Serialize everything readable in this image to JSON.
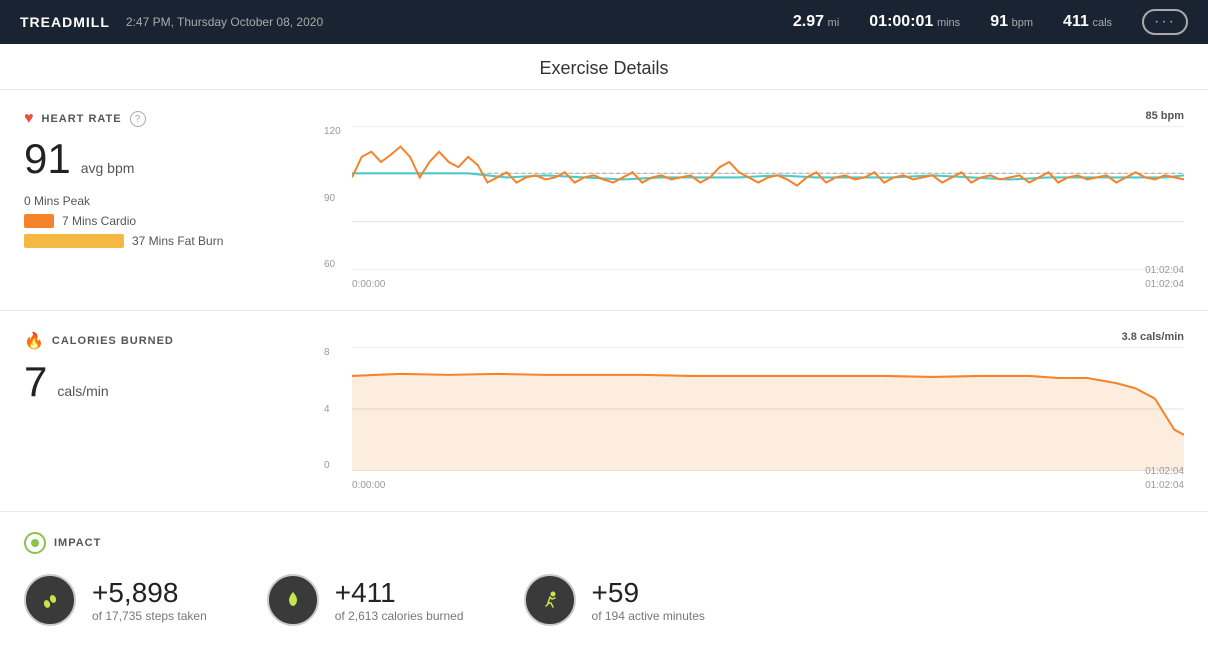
{
  "topbar": {
    "title": "TREADMILL",
    "datetime": "2:47 PM, Thursday October 08, 2020",
    "stats": [
      {
        "value": "2.97",
        "unit": "mi"
      },
      {
        "value": "01:00:01",
        "unit": "mins"
      },
      {
        "value": "91",
        "unit": "bpm"
      },
      {
        "value": "411",
        "unit": "cals"
      }
    ],
    "more_label": "···"
  },
  "page_title": "Exercise Details",
  "heart_rate": {
    "section_title": "HEART RATE",
    "avg_value": "91",
    "avg_unit": "avg bpm",
    "zones": [
      {
        "label": "0 Mins Peak",
        "color": null,
        "swatch_width": 0
      },
      {
        "label": "7 Mins Cardio",
        "color": "#f4832a",
        "swatch_width": 30
      },
      {
        "label": "37 Mins Fat Burn",
        "color": "#f4b942",
        "swatch_width": 100
      }
    ],
    "chart_top_value": "85 bpm",
    "chart_y_top": "120",
    "chart_y_mid": "90",
    "chart_y_bot": "60",
    "chart_x_start": "0:00:00",
    "chart_x_end": "01:02:04",
    "chart_time_label": "01:02:04"
  },
  "calories": {
    "section_title": "CALORIES BURNED",
    "value": "7",
    "unit": "cals/min",
    "chart_top_value": "3.8 cals/min",
    "chart_y_top": "8",
    "chart_y_mid": "4",
    "chart_y_bot": "0",
    "chart_x_start": "0:00:00",
    "chart_x_end": "01:02:04",
    "chart_time_label": "01:02:04"
  },
  "impact": {
    "section_title": "IMPACT",
    "items": [
      {
        "icon": "steps",
        "value": "+5,898",
        "desc": "of 17,735 steps taken"
      },
      {
        "icon": "fire",
        "value": "+411",
        "desc": "of 2,613 calories burned"
      },
      {
        "icon": "run",
        "value": "+59",
        "desc": "of 194 active minutes"
      }
    ]
  }
}
